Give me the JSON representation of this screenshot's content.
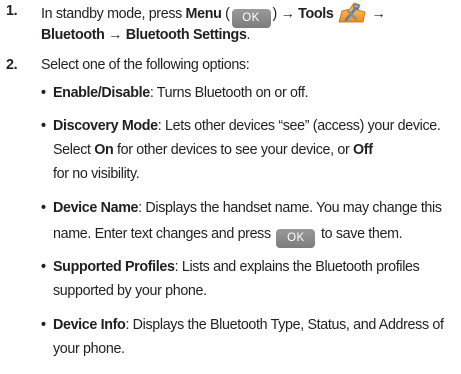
{
  "steps": [
    {
      "number": "1.",
      "line1": {
        "a": "In standby mode, press ",
        "menu": "Menu",
        "paren_open": " (",
        "ok_key": "OK",
        "paren_close": ") ",
        "arrow1": "→ ",
        "tools": "Tools",
        "tools_icon": "tools-icon",
        "arrow2": "→"
      },
      "line2": {
        "bluetooth": "Bluetooth",
        "arrow": " → ",
        "settings": "Bluetooth Settings",
        "period": "."
      }
    },
    {
      "number": "2.",
      "text": "Select one of the following options:"
    }
  ],
  "options": [
    {
      "term": "Enable/Disable",
      "lines": [
        ": Turns Bluetooth on or off."
      ]
    },
    {
      "term": "Discovery Mode",
      "lines": [
        ": Lets other devices “see” (access) your device.",
        "Select ",
        "On",
        " for other devices to see your device, or ",
        "Off",
        "for no visibility."
      ]
    },
    {
      "term": "Device Name",
      "lines": [
        ": Displays the handset name. You may change this",
        "name. Enter text changes and press ",
        "OK",
        " to save them."
      ]
    },
    {
      "term": "Supported Profiles",
      "lines": [
        ": Lists and explains the Bluetooth profiles",
        "supported by your phone."
      ]
    },
    {
      "term": "Device Info",
      "lines": [
        ": Displays the Bluetooth Type, Status, and Address of",
        "your phone."
      ]
    }
  ],
  "bullet": "•",
  "colors": {
    "text": "#231f20",
    "ok_key_bg": "#8a8a8a",
    "tools_icon_primary": "#f5a623"
  }
}
